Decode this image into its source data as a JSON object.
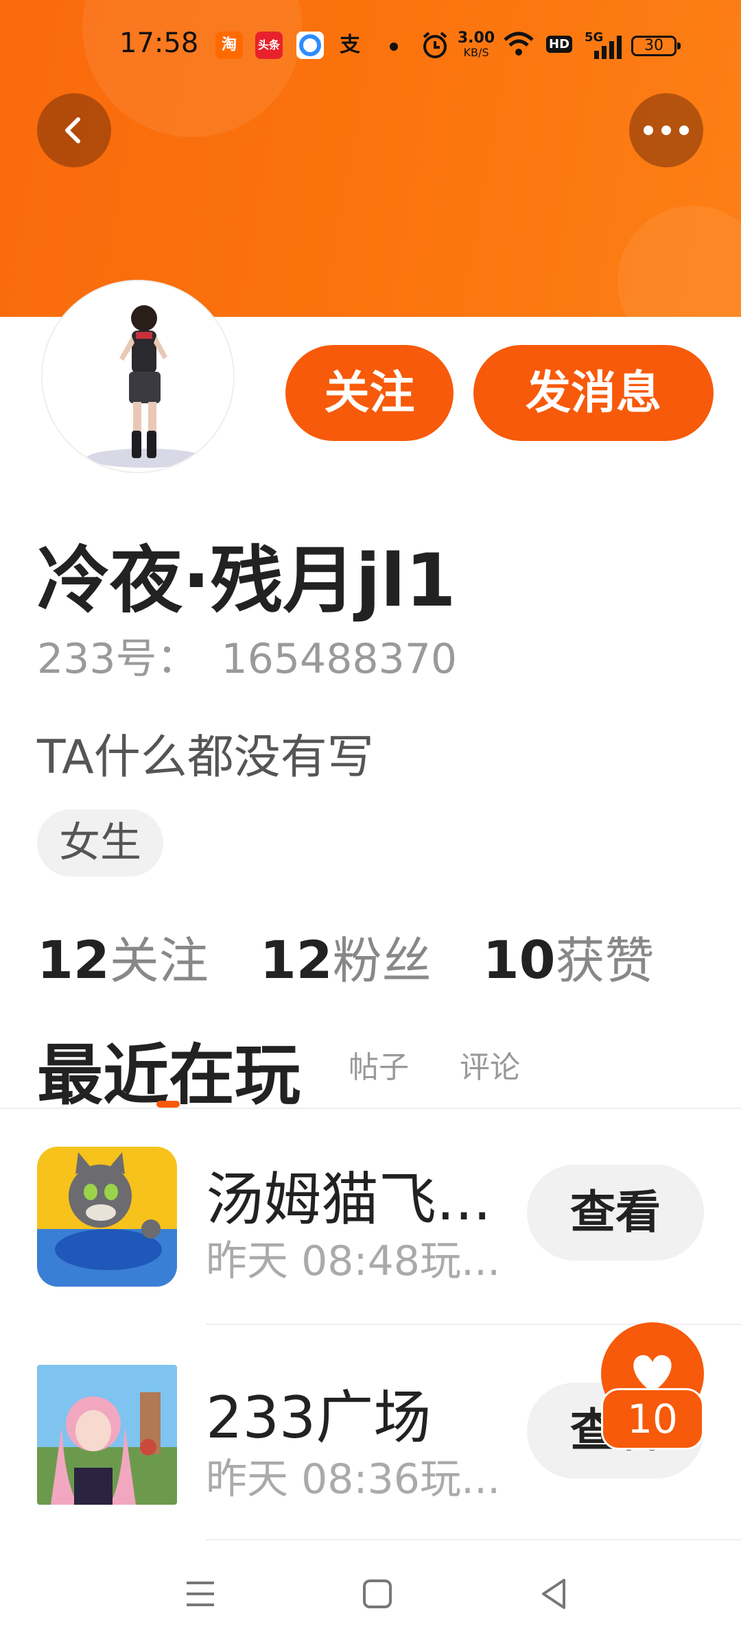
{
  "status_bar": {
    "time": "17:58",
    "apps": [
      {
        "name": "taobao-icon",
        "glyph": "淘",
        "color": "#ff6a00"
      },
      {
        "name": "toutiao-icon",
        "glyph": "头条",
        "color": "#e8222c"
      },
      {
        "name": "browser-icon",
        "glyph": "",
        "color": "#2f8cff"
      },
      {
        "name": "alipay-icon",
        "glyph": "支",
        "color": "#111111"
      }
    ],
    "net_speed_value": "3.00",
    "net_speed_unit": "KB/S",
    "hd_label": "HD",
    "signal_label": "5G",
    "battery": "30"
  },
  "header": {
    "background_color": "#fb720d",
    "back_icon": "chevron-left-icon",
    "more_icon": "more-horizontal-icon"
  },
  "profile": {
    "follow_label": "关注",
    "message_label": "发消息",
    "username": "冷夜·残月jl1",
    "uid_label": "233号：",
    "uid_value": "165488370",
    "bio": "TA什么都没有写",
    "gender": "女生",
    "stats": [
      {
        "num": "12",
        "label": "关注"
      },
      {
        "num": "12",
        "label": "粉丝"
      },
      {
        "num": "10",
        "label": "获赞"
      }
    ]
  },
  "tabs": {
    "active": "最近在玩",
    "others": [
      "帖子",
      "评论"
    ]
  },
  "games": [
    {
      "name": "汤姆猫飞...",
      "time": "昨天 08:48玩...",
      "action": "查看"
    },
    {
      "name": "233广场",
      "time": "昨天 08:36玩...",
      "action": "查看"
    }
  ],
  "like_badge": {
    "count": "10",
    "icon": "heart-icon"
  },
  "accent_color": "#f75a0a",
  "nav_bar": {
    "items": [
      "menu-icon",
      "home-square-icon",
      "back-triangle-icon"
    ]
  }
}
